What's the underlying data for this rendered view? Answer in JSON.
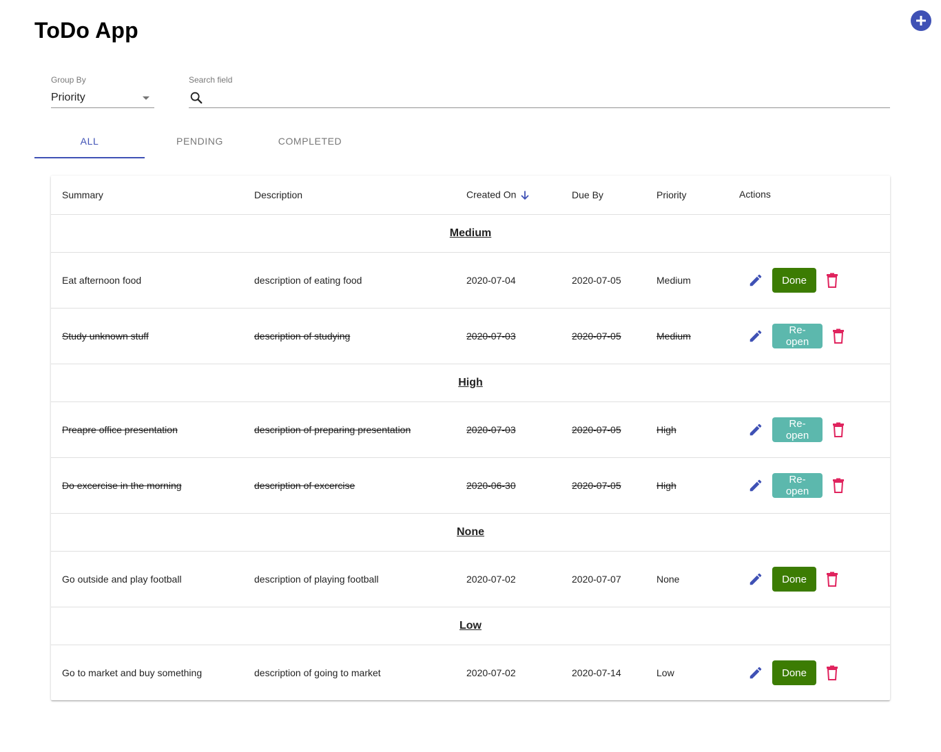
{
  "app": {
    "title": "ToDo App"
  },
  "controls": {
    "group_by_label": "Group By",
    "group_by_value": "Priority",
    "search_label": "Search field",
    "search_value": ""
  },
  "tabs": [
    {
      "label": "ALL",
      "active": true
    },
    {
      "label": "PENDING",
      "active": false
    },
    {
      "label": "COMPLETED",
      "active": false
    }
  ],
  "table": {
    "headers": {
      "summary": "Summary",
      "description": "Description",
      "created_on": "Created On",
      "due_by": "Due By",
      "priority": "Priority",
      "actions": "Actions"
    },
    "sort_column": "created_on",
    "sort_direction": "descending"
  },
  "groups": [
    {
      "name": "Medium",
      "rows": [
        {
          "summary": "Eat afternoon food",
          "description": "description of eating food",
          "created_on": "2020-07-04",
          "due_by": "2020-07-05",
          "priority": "Medium",
          "completed": false,
          "action_label": "Done"
        },
        {
          "summary": "Study unknown stuff",
          "description": "description of studying",
          "created_on": "2020-07-03",
          "due_by": "2020-07-05",
          "priority": "Medium",
          "completed": true,
          "action_label": "Re-open"
        }
      ]
    },
    {
      "name": "High",
      "rows": [
        {
          "summary": "Preapre office presentation",
          "description": "description of preparing presentation",
          "created_on": "2020-07-03",
          "due_by": "2020-07-05",
          "priority": "High",
          "completed": true,
          "action_label": "Re-open"
        },
        {
          "summary": "Do excercise in the morning",
          "description": "description of excercise",
          "created_on": "2020-06-30",
          "due_by": "2020-07-05",
          "priority": "High",
          "completed": true,
          "action_label": "Re-open"
        }
      ]
    },
    {
      "name": "None",
      "rows": [
        {
          "summary": "Go outside and play football",
          "description": "description of playing football",
          "created_on": "2020-07-02",
          "due_by": "2020-07-07",
          "priority": "None",
          "completed": false,
          "action_label": "Done"
        }
      ]
    },
    {
      "name": "Low",
      "rows": [
        {
          "summary": "Go to market and buy something",
          "description": "description of going to market",
          "created_on": "2020-07-02",
          "due_by": "2020-07-14",
          "priority": "Low",
          "completed": false,
          "action_label": "Done"
        }
      ]
    }
  ],
  "icons": {
    "add": "add-circle-icon",
    "dropdown": "arrow-drop-down-icon",
    "search": "search-icon",
    "sort": "arrow-downward-icon",
    "edit": "pencil-icon",
    "delete": "trash-icon"
  },
  "colors": {
    "primary": "#3f51b5",
    "done_button": "#3c7c03",
    "reopen_button": "#5cb8ad",
    "delete_icon": "#e0245e"
  }
}
